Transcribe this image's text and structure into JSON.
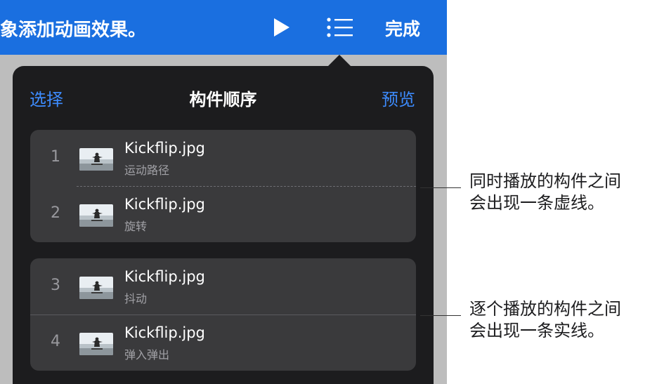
{
  "toolbar": {
    "title": "象添加动画效果。",
    "done_label": "完成",
    "background_color": "#1a6fe0",
    "icons": [
      "play-icon",
      "list-icon"
    ]
  },
  "popover": {
    "select_label": "选择",
    "title": "构件顺序",
    "preview_label": "预览",
    "accent_color": "#3d8bfd",
    "groups": [
      {
        "separator": "dashed",
        "rows": [
          {
            "number": "1",
            "name": "Kickflip.jpg",
            "effect": "运动路径"
          },
          {
            "number": "2",
            "name": "Kickflip.jpg",
            "effect": "旋转"
          }
        ]
      },
      {
        "separator": "solid",
        "rows": [
          {
            "number": "3",
            "name": "Kickflip.jpg",
            "effect": "抖动"
          },
          {
            "number": "4",
            "name": "Kickflip.jpg",
            "effect": "弹入弹出"
          }
        ]
      }
    ]
  },
  "callouts": [
    {
      "line1": "同时播放的构件之间",
      "line2": "会出现一条虚线。"
    },
    {
      "line1": "逐个播放的构件之间",
      "line2": "会出现一条实线。"
    }
  ]
}
